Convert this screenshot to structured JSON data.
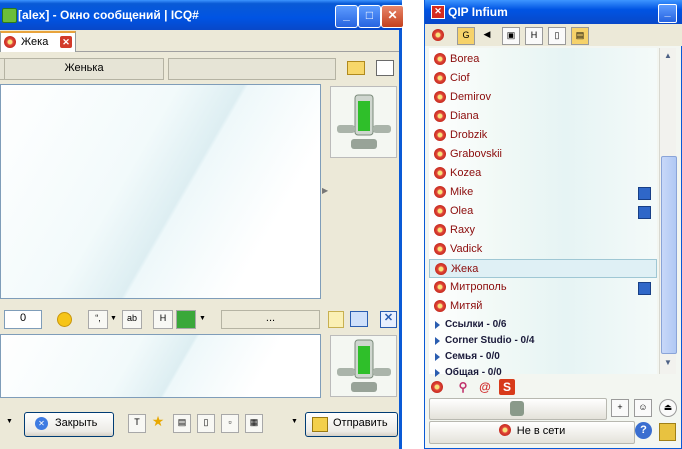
{
  "chat": {
    "title": "[alex] - Окно сообщений | ICQ#",
    "tab_label": "Жека",
    "contact_nick": "Женька",
    "message_count": "0",
    "dots": "...",
    "close_label": "Закрыть",
    "send_label": "Отправить"
  },
  "qip": {
    "title": "QIP Infium",
    "contacts": [
      {
        "name": "Borea",
        "selected": false,
        "message": false
      },
      {
        "name": "Ciof",
        "selected": false,
        "message": false
      },
      {
        "name": "Demirov",
        "selected": false,
        "message": false
      },
      {
        "name": "Diana",
        "selected": false,
        "message": false
      },
      {
        "name": "Drobzik",
        "selected": false,
        "message": false
      },
      {
        "name": "Grabovskii",
        "selected": false,
        "message": false
      },
      {
        "name": "Kozea",
        "selected": false,
        "message": false
      },
      {
        "name": "Mike",
        "selected": false,
        "message": true
      },
      {
        "name": "Olea",
        "selected": false,
        "message": true
      },
      {
        "name": "Raxy",
        "selected": false,
        "message": false
      },
      {
        "name": "Vadick",
        "selected": false,
        "message": false
      },
      {
        "name": "Жека",
        "selected": true,
        "message": false
      },
      {
        "name": "Митрополь",
        "selected": false,
        "message": true
      },
      {
        "name": "Митяй",
        "selected": false,
        "message": false
      }
    ],
    "groups": [
      {
        "name": "Ссылки - 0/6"
      },
      {
        "name": "Corner Studio - 0/4"
      },
      {
        "name": "Семья - 0/0"
      },
      {
        "name": "Общая - 0/0"
      }
    ],
    "status_label": "Не в сети"
  },
  "colors": {
    "title_bar": "#0054e3",
    "contact_name": "#8b0c0c",
    "selected_row": "#dff0f5",
    "window_bg": "#ece9d8"
  }
}
